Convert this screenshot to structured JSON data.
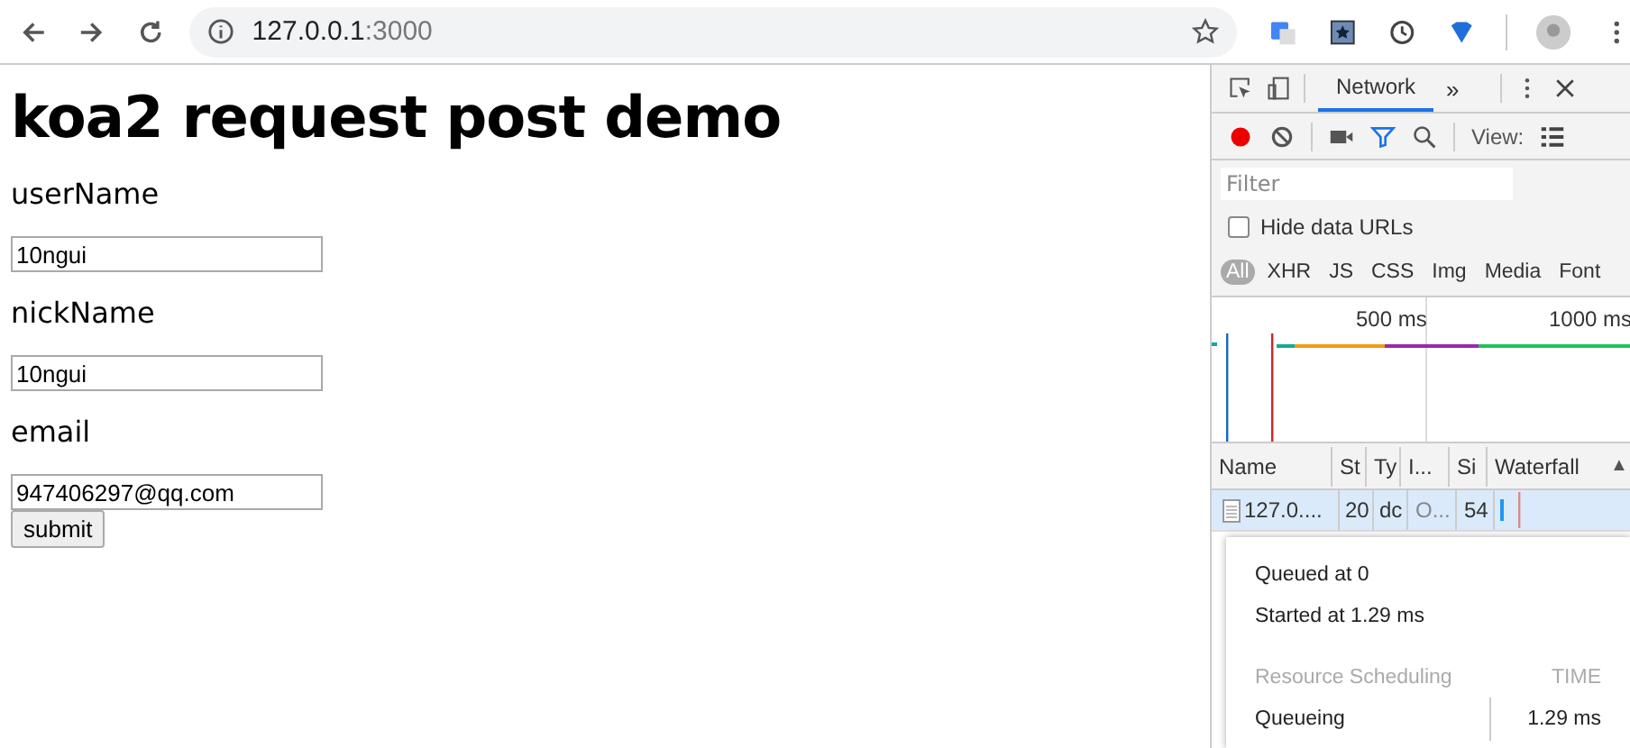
{
  "browser": {
    "address_host": "127.0.0.1",
    "address_port": ":3000"
  },
  "page": {
    "title": "koa2 request post demo",
    "fields": [
      {
        "label": "userName",
        "value": "10ngui"
      },
      {
        "label": "nickName",
        "value": "10ngui"
      },
      {
        "label": "email",
        "value": "947406297@qq.com"
      }
    ],
    "submit": "submit"
  },
  "devtools": {
    "tabs": [
      {
        "label": "Network",
        "selected": true
      }
    ],
    "more": "»",
    "recording": true,
    "view_label": "View:",
    "filter": {
      "placeholder": "Filter"
    },
    "hide_data_urls": {
      "label": "Hide data URLs",
      "checked": false
    },
    "type_filters": [
      {
        "label": "All",
        "selected": true
      },
      {
        "label": "XHR",
        "selected": false
      },
      {
        "label": "JS",
        "selected": false
      },
      {
        "label": "CSS",
        "selected": false
      },
      {
        "label": "Img",
        "selected": false
      },
      {
        "label": "Media",
        "selected": false
      },
      {
        "label": "Font",
        "selected": false
      }
    ],
    "timeline_ticks": [
      "500 ms",
      "1000 ms"
    ],
    "columns": [
      "Name",
      "St",
      "Ty",
      "I...",
      "Si",
      "Waterfall"
    ],
    "sort_indicator": "▲",
    "rows": [
      {
        "cells": [
          "127.0....",
          "20",
          "dc",
          "O...",
          "54"
        ],
        "selected": true
      }
    ],
    "popup": {
      "queued": "Queued at 0",
      "started": "Started at 1.29 ms",
      "section": "Resource Scheduling",
      "section_right": "TIME",
      "rows": [
        {
          "label": "Queueing",
          "value": "1.29 ms"
        }
      ]
    }
  }
}
